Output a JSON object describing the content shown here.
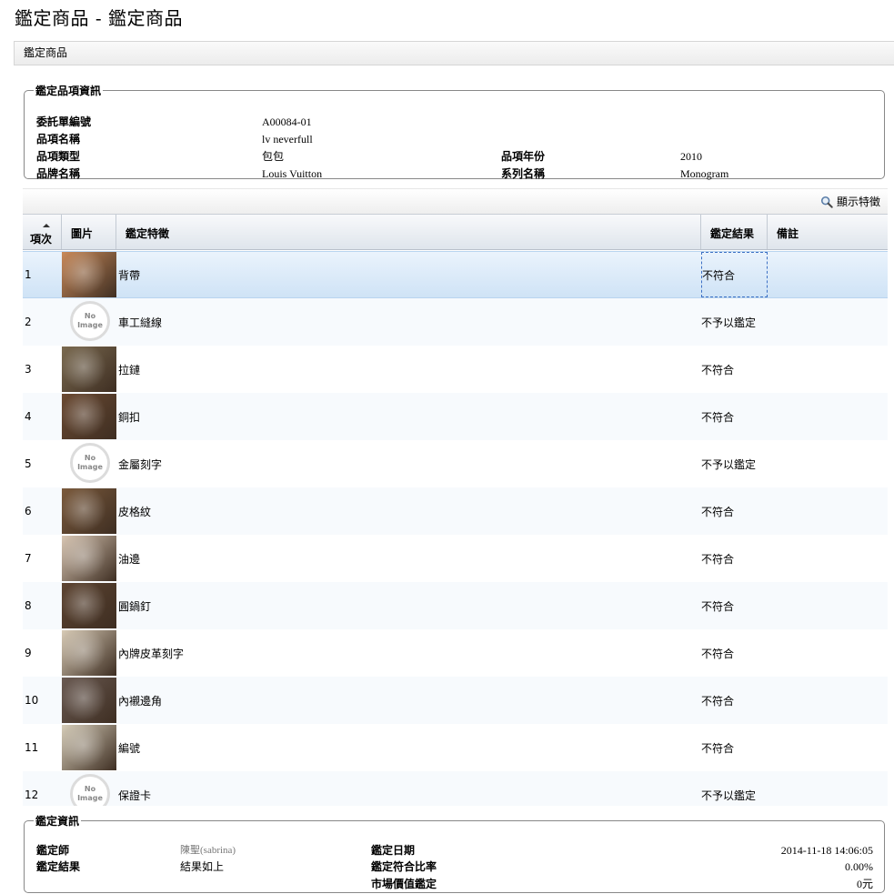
{
  "page": {
    "title": "鑑定商品 - 鑑定商品"
  },
  "breadcrumb": {
    "label": "鑑定商品"
  },
  "item_info": {
    "legend": "鑑定品項資訊",
    "fields": {
      "order_no": {
        "label": "委託單編號",
        "value": "A00084-01"
      },
      "item_name": {
        "label": "品項名稱",
        "value": "lv neverfull"
      },
      "item_type": {
        "label": "品項類型",
        "value": "包包"
      },
      "item_year": {
        "label": "品項年份",
        "value": "2010"
      },
      "brand": {
        "label": "品牌名稱",
        "value": "Louis Vuitton"
      },
      "series": {
        "label": "系列名稱",
        "value": "Monogram"
      }
    }
  },
  "toolbar": {
    "show_features_label": "顯示特徵",
    "icon": "magnifier-icon"
  },
  "table": {
    "columns": {
      "index": "項次",
      "image": "圖片",
      "feature": "鑑定特徵",
      "result": "鑑定結果",
      "note": "備註"
    },
    "no_image": {
      "line1": "No",
      "line2": "Image"
    },
    "rows": [
      {
        "index": "1",
        "feature": "背帶",
        "result": "不符合",
        "note": "",
        "image": "strap-photo",
        "color": "#c98a5a"
      },
      {
        "index": "2",
        "feature": "車工縫線",
        "result": "不予以鑑定",
        "note": "",
        "image": "no-image",
        "color": ""
      },
      {
        "index": "3",
        "feature": "拉鏈",
        "result": "不符合",
        "note": "",
        "image": "zipper-photo",
        "color": "#7a6a50"
      },
      {
        "index": "4",
        "feature": "銅扣",
        "result": "不符合",
        "note": "",
        "image": "buckle-photo",
        "color": "#6b4a32"
      },
      {
        "index": "5",
        "feature": "金屬刻字",
        "result": "不予以鑑定",
        "note": "",
        "image": "no-image",
        "color": ""
      },
      {
        "index": "6",
        "feature": "皮格紋",
        "result": "不符合",
        "note": "",
        "image": "monogram-photo",
        "color": "#7b5a3c"
      },
      {
        "index": "7",
        "feature": "油邊",
        "result": "不符合",
        "note": "",
        "image": "edge-photo",
        "color": "#d9c7b4"
      },
      {
        "index": "8",
        "feature": "圓鍋釘",
        "result": "不符合",
        "note": "",
        "image": "rivet-photo",
        "color": "#5d4431"
      },
      {
        "index": "9",
        "feature": "內牌皮革刻字",
        "result": "不符合",
        "note": "",
        "image": "tag-photo",
        "color": "#d8cbb6"
      },
      {
        "index": "10",
        "feature": "內襯邊角",
        "result": "不符合",
        "note": "",
        "image": "lining-photo",
        "color": "#6a5a52"
      },
      {
        "index": "11",
        "feature": "編號",
        "result": "不符合",
        "note": "",
        "image": "serial-photo",
        "color": "#d6cdb9"
      },
      {
        "index": "12",
        "feature": "保證卡",
        "result": "不予以鑑定",
        "note": "",
        "image": "no-image",
        "color": ""
      }
    ]
  },
  "result_info": {
    "legend": "鑑定資訊",
    "appraiser": {
      "label": "鑑定師",
      "value": "陳聖(sabrina)"
    },
    "date": {
      "label": "鑑定日期",
      "value": "2014-11-18 14:06:05"
    },
    "result": {
      "label": "鑑定結果",
      "value": "結果如上"
    },
    "match_rate": {
      "label": "鑑定符合比率",
      "value": "0.00%"
    },
    "market_value": {
      "label": "市場價值鑑定",
      "value": "0元"
    }
  },
  "colors": {
    "selected_row": "#d4e6f8",
    "focus_border": "#3b6fc4",
    "header_bg": "#e3e8ee"
  }
}
